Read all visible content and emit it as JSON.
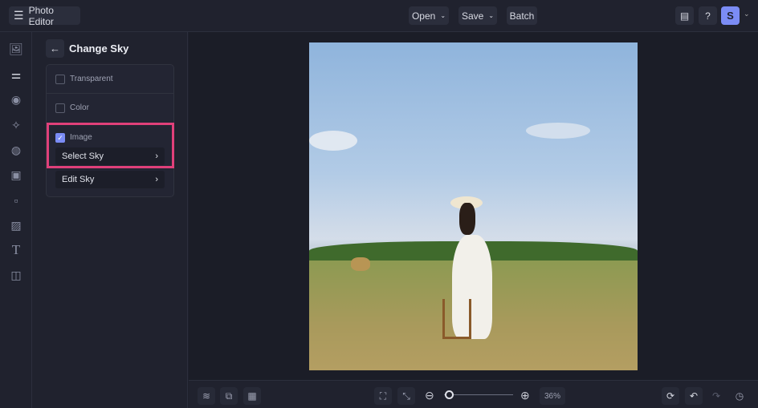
{
  "header": {
    "title": "Photo Editor",
    "open": "Open",
    "save": "Save",
    "batch": "Batch",
    "avatar": "S"
  },
  "panel": {
    "title": "Change Sky",
    "options": [
      {
        "label": "Transparent",
        "checked": false
      },
      {
        "label": "Color",
        "checked": false
      },
      {
        "label": "Image",
        "checked": true
      }
    ],
    "select_sky": "Select Sky",
    "edit_sky": "Edit Sky"
  },
  "zoom": {
    "value": "36%",
    "level_percent": 36
  },
  "colors": {
    "accent": "#7b8cf5",
    "highlight": "#e0407a"
  }
}
